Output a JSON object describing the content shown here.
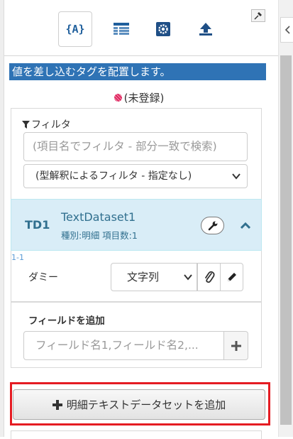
{
  "toolbar": {
    "tabs": [
      {
        "icon": "tag-braces-icon",
        "active": true
      },
      {
        "icon": "table-icon",
        "active": false
      },
      {
        "icon": "settings-gear-icon",
        "active": false
      },
      {
        "icon": "upload-icon",
        "active": false
      }
    ],
    "pin_icon": "pin-icon"
  },
  "banner": {
    "text": "値を差し込むタグを配置します。"
  },
  "status": {
    "text": "(未登録)"
  },
  "filter": {
    "label": "フィルタ",
    "input_placeholder": "(項目名でフィルタ - 部分一致で検索)",
    "select_value": "(型解釈によるフィルタ - 指定なし)"
  },
  "dataset": {
    "code": "TD1",
    "name": "TextDataset1",
    "meta": "種別:明細  項目数:1"
  },
  "fields": [
    {
      "index": "1-1",
      "name": "ダミー",
      "type": "文字列"
    }
  ],
  "add_field": {
    "label": "フィールドを追加",
    "placeholder": "フィールド名1,フィールド名2,..."
  },
  "add_dataset_button": {
    "label": "明細テキストデータセットを追加"
  },
  "colors": {
    "banner": "#2f73b5",
    "dataset_header_bg": "#d9edf7",
    "dataset_text": "#31708f",
    "highlight": "#e51c23"
  }
}
